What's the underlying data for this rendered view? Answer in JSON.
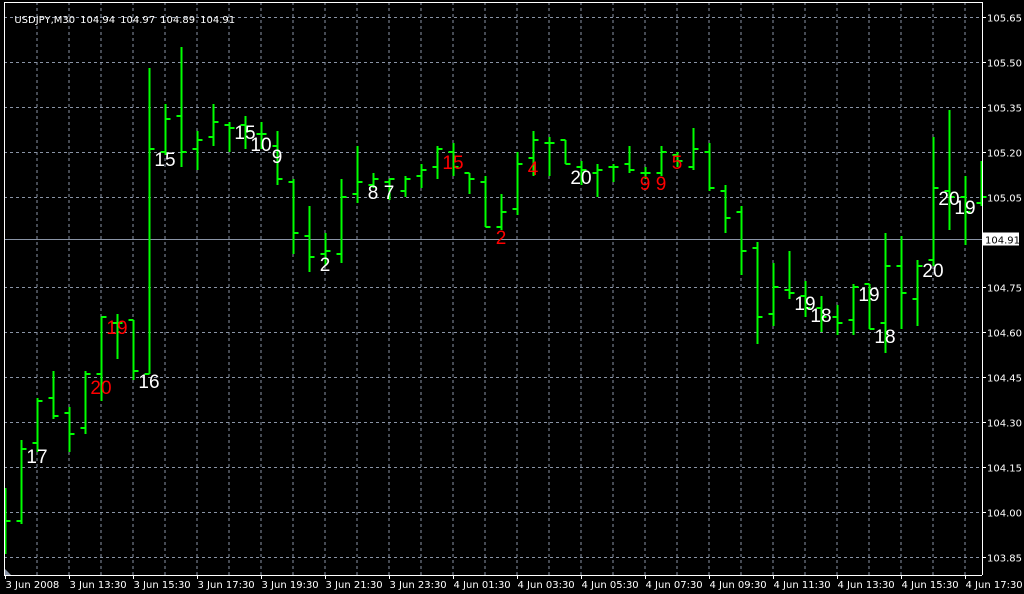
{
  "header": {
    "symbol": "USDJPY,M30",
    "ohlc": [
      "104.94",
      "104.97",
      "104.89",
      "104.91"
    ]
  },
  "colors": {
    "background": "#000000",
    "bar": "#00ff00",
    "grid": "#8a94a6",
    "axis": "#ffffff",
    "label_white": "#ffffff",
    "label_red": "#ff0000",
    "current_price_line": "#8a94a6"
  },
  "chart_data": {
    "type": "ohlc-bar",
    "symbol": "USDJPY",
    "timeframe": "M30",
    "grid": true,
    "ylim": [
      103.85,
      105.65
    ],
    "y_ticks": [
      "105.65",
      "105.50",
      "105.35",
      "105.20",
      "105.05",
      "104.91",
      "104.75",
      "104.60",
      "104.45",
      "104.30",
      "104.15",
      "104.00",
      "103.85"
    ],
    "current_price": "104.91",
    "x_tick_labels": [
      {
        "bar": 0,
        "label": "3 Jun 2008"
      },
      {
        "bar": 4,
        "label": "3 Jun 13:30"
      },
      {
        "bar": 8,
        "label": "3 Jun 15:30"
      },
      {
        "bar": 12,
        "label": "3 Jun 17:30"
      },
      {
        "bar": 16,
        "label": "3 Jun 19:30"
      },
      {
        "bar": 20,
        "label": "3 Jun 21:30"
      },
      {
        "bar": 24,
        "label": "3 Jun 23:30"
      },
      {
        "bar": 28,
        "label": "4 Jun 01:30"
      },
      {
        "bar": 32,
        "label": "4 Jun 03:30"
      },
      {
        "bar": 36,
        "label": "4 Jun 05:30"
      },
      {
        "bar": 40,
        "label": "4 Jun 07:30"
      },
      {
        "bar": 44,
        "label": "4 Jun 09:30"
      },
      {
        "bar": 48,
        "label": "4 Jun 11:30"
      },
      {
        "bar": 52,
        "label": "4 Jun 13:30"
      },
      {
        "bar": 56,
        "label": "4 Jun 15:30"
      },
      {
        "bar": 60,
        "label": "4 Jun 17:30"
      }
    ],
    "bars": [
      [
        103.91,
        104.08,
        103.86,
        103.97
      ],
      [
        103.97,
        104.24,
        103.96,
        104.21
      ],
      [
        104.23,
        104.38,
        104.2,
        104.37
      ],
      [
        104.38,
        104.47,
        104.31,
        104.32
      ],
      [
        104.33,
        104.35,
        104.2,
        104.26
      ],
      [
        104.28,
        104.47,
        104.26,
        104.46
      ],
      [
        104.46,
        104.65,
        104.37,
        104.65
      ],
      [
        104.63,
        104.66,
        104.51,
        104.63
      ],
      [
        104.64,
        104.64,
        104.44,
        104.47
      ],
      [
        104.46,
        105.48,
        104.46,
        105.21
      ],
      [
        105.2,
        105.36,
        105.19,
        105.31
      ],
      [
        105.32,
        105.55,
        105.15,
        105.2
      ],
      [
        105.21,
        105.27,
        105.14,
        105.24
      ],
      [
        105.25,
        105.36,
        105.22,
        105.3
      ],
      [
        105.29,
        105.3,
        105.2,
        105.28
      ],
      [
        105.29,
        105.32,
        105.21,
        105.27
      ],
      [
        105.26,
        105.3,
        105.21,
        105.26
      ],
      [
        105.22,
        105.27,
        105.09,
        105.11
      ],
      [
        105.1,
        105.11,
        104.86,
        104.93
      ],
      [
        104.92,
        105.02,
        104.8,
        104.85
      ],
      [
        104.86,
        104.93,
        104.82,
        104.87
      ],
      [
        104.86,
        105.11,
        104.83,
        105.05
      ],
      [
        105.06,
        105.22,
        105.03,
        105.1
      ],
      [
        105.09,
        105.13,
        105.08,
        105.11
      ],
      [
        105.1,
        105.11,
        105.04,
        105.11
      ],
      [
        105.07,
        105.12,
        105.05,
        105.11
      ],
      [
        105.12,
        105.16,
        105.08,
        105.14
      ],
      [
        105.15,
        105.22,
        105.11,
        105.21
      ],
      [
        105.2,
        105.23,
        105.12,
        105.15
      ],
      [
        105.13,
        105.13,
        105.06,
        105.11
      ],
      [
        105.1,
        105.12,
        104.95,
        104.95
      ],
      [
        104.95,
        105.06,
        104.94,
        105.0
      ],
      [
        105.01,
        105.2,
        104.99,
        105.16
      ],
      [
        105.18,
        105.27,
        105.12,
        105.24
      ],
      [
        105.23,
        105.25,
        105.12,
        105.23
      ],
      [
        105.24,
        105.24,
        105.16,
        105.16
      ],
      [
        105.15,
        105.17,
        105.09,
        105.14
      ],
      [
        105.13,
        105.16,
        105.05,
        105.14
      ],
      [
        105.15,
        105.16,
        105.1,
        105.15
      ],
      [
        105.16,
        105.22,
        105.13,
        105.14
      ],
      [
        105.13,
        105.15,
        105.11,
        105.13
      ],
      [
        105.13,
        105.22,
        105.12,
        105.2
      ],
      [
        105.19,
        105.2,
        105.15,
        105.17
      ],
      [
        105.15,
        105.28,
        105.14,
        105.21
      ],
      [
        105.2,
        105.23,
        105.07,
        105.08
      ],
      [
        105.07,
        105.09,
        104.93,
        104.98
      ],
      [
        105.0,
        105.02,
        104.79,
        104.87
      ],
      [
        104.88,
        104.9,
        104.56,
        104.65
      ],
      [
        104.66,
        104.83,
        104.62,
        104.75
      ],
      [
        104.74,
        104.87,
        104.71,
        104.73
      ],
      [
        104.72,
        104.77,
        104.65,
        104.68
      ],
      [
        104.68,
        104.72,
        104.6,
        104.65
      ],
      [
        104.65,
        104.69,
        104.59,
        104.63
      ],
      [
        104.64,
        104.76,
        104.59,
        104.75
      ],
      [
        104.76,
        104.76,
        104.61,
        104.61
      ],
      [
        104.63,
        104.93,
        104.53,
        104.82
      ],
      [
        104.82,
        104.92,
        104.61,
        104.73
      ],
      [
        104.71,
        104.84,
        104.62,
        104.82
      ],
      [
        104.84,
        105.25,
        104.82,
        105.08
      ],
      [
        105.07,
        105.34,
        104.94,
        105.05
      ],
      [
        105.05,
        105.12,
        104.89,
        105.0
      ],
      [
        105.03,
        105.17,
        105.02,
        105.05
      ]
    ],
    "annotations": [
      {
        "bar": 2,
        "price": 104.18,
        "text": "17",
        "color": "white"
      },
      {
        "bar": 6,
        "price": 104.41,
        "text": "20",
        "color": "red"
      },
      {
        "bar": 7,
        "price": 104.61,
        "text": "19",
        "color": "red"
      },
      {
        "bar": 9,
        "price": 104.43,
        "text": "16",
        "color": "white"
      },
      {
        "bar": 10,
        "price": 105.17,
        "text": "15",
        "color": "white"
      },
      {
        "bar": 15,
        "price": 105.26,
        "text": "15",
        "color": "white"
      },
      {
        "bar": 16,
        "price": 105.22,
        "text": "10",
        "color": "white"
      },
      {
        "bar": 17,
        "price": 105.18,
        "text": "9",
        "color": "white"
      },
      {
        "bar": 20,
        "price": 104.82,
        "text": "2",
        "color": "white"
      },
      {
        "bar": 23,
        "price": 105.06,
        "text": "8",
        "color": "white"
      },
      {
        "bar": 24,
        "price": 105.06,
        "text": "7",
        "color": "white"
      },
      {
        "bar": 28,
        "price": 105.16,
        "text": "15",
        "color": "red"
      },
      {
        "bar": 31,
        "price": 104.91,
        "text": "2",
        "color": "red"
      },
      {
        "bar": 33,
        "price": 105.14,
        "text": "4",
        "color": "red"
      },
      {
        "bar": 36,
        "price": 105.11,
        "text": "20",
        "color": "white"
      },
      {
        "bar": 40,
        "price": 105.09,
        "text": "9",
        "color": "red"
      },
      {
        "bar": 41,
        "price": 105.09,
        "text": "9",
        "color": "red"
      },
      {
        "bar": 42,
        "price": 105.16,
        "text": "5",
        "color": "red"
      },
      {
        "bar": 50,
        "price": 104.69,
        "text": "19",
        "color": "white"
      },
      {
        "bar": 51,
        "price": 104.65,
        "text": "18",
        "color": "white"
      },
      {
        "bar": 54,
        "price": 104.72,
        "text": "19",
        "color": "white"
      },
      {
        "bar": 55,
        "price": 104.58,
        "text": "18",
        "color": "white"
      },
      {
        "bar": 58,
        "price": 104.8,
        "text": "20",
        "color": "white"
      },
      {
        "bar": 59,
        "price": 105.04,
        "text": "20",
        "color": "white"
      },
      {
        "bar": 60,
        "price": 105.01,
        "text": "19",
        "color": "white"
      }
    ]
  }
}
